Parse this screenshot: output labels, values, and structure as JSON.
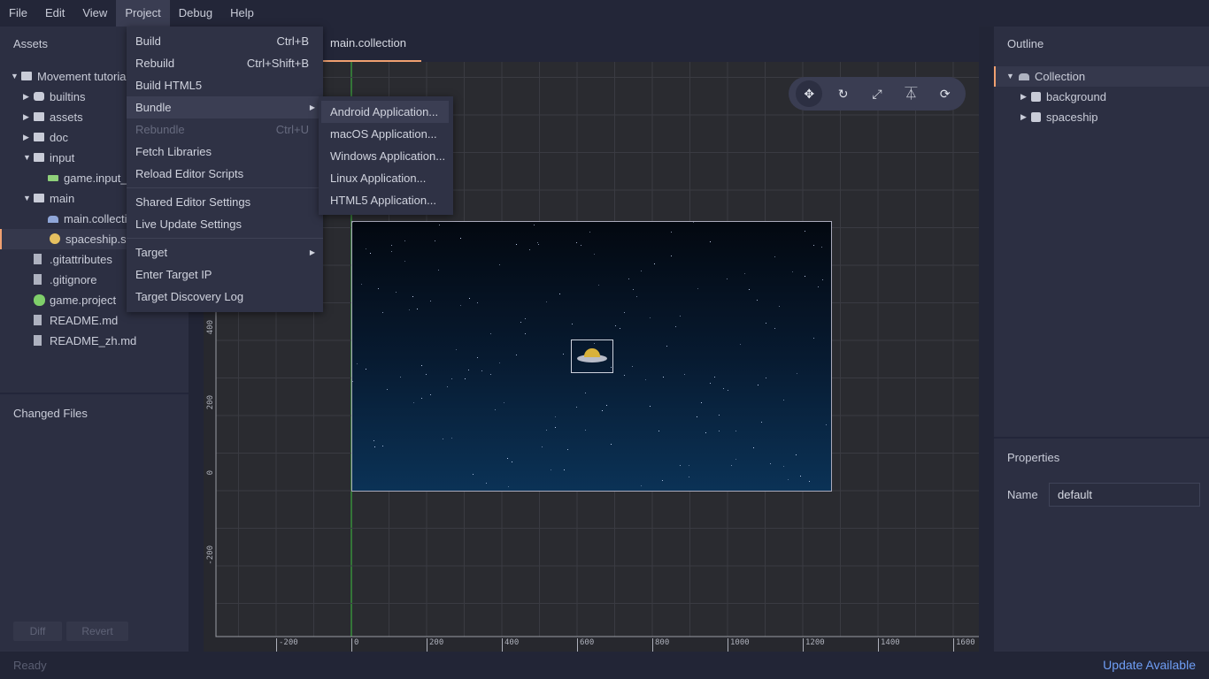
{
  "menubar": {
    "items": [
      "File",
      "Edit",
      "View",
      "Project",
      "Debug",
      "Help"
    ],
    "open": "Project"
  },
  "assets": {
    "title": "Assets",
    "tree": [
      {
        "label": "Movement tutorial",
        "icon": "folder-icon",
        "indent": 0,
        "expanded": true
      },
      {
        "label": "builtins",
        "icon": "puzzle-icon",
        "indent": 1,
        "expanded": false
      },
      {
        "label": "assets",
        "icon": "folder-icon",
        "indent": 1,
        "expanded": false
      },
      {
        "label": "doc",
        "icon": "folder-icon",
        "indent": 1,
        "expanded": false
      },
      {
        "label": "input",
        "icon": "folder-icon",
        "indent": 1,
        "expanded": true
      },
      {
        "label": "game.input_binding",
        "icon": "input-binding-icon",
        "indent": 2
      },
      {
        "label": "main",
        "icon": "folder-icon",
        "indent": 1,
        "expanded": true
      },
      {
        "label": "main.collection",
        "icon": "collection-icon",
        "indent": 2
      },
      {
        "label": "spaceship.script",
        "icon": "script-gear-icon",
        "indent": 2,
        "selected": true
      },
      {
        "label": ".gitattributes",
        "icon": "file-icon",
        "indent": 1
      },
      {
        "label": ".gitignore",
        "icon": "file-icon",
        "indent": 1
      },
      {
        "label": "game.project",
        "icon": "project-icon",
        "indent": 1
      },
      {
        "label": "README.md",
        "icon": "file-icon",
        "indent": 1
      },
      {
        "label": "README_zh.md",
        "icon": "file-icon",
        "indent": 1
      }
    ]
  },
  "changed_files": {
    "title": "Changed Files",
    "diff": "Diff",
    "revert": "Revert"
  },
  "tab": {
    "label": "main.collection"
  },
  "project_menu": [
    {
      "label": "Build",
      "shortcut": "Ctrl+B"
    },
    {
      "label": "Rebuild",
      "shortcut": "Ctrl+Shift+B"
    },
    {
      "label": "Build HTML5",
      "shortcut": ""
    },
    {
      "label": "Bundle",
      "shortcut": "",
      "submenu": true,
      "highlighted": true
    },
    {
      "label": "Rebundle",
      "shortcut": "Ctrl+U",
      "disabled": true
    },
    {
      "label": "Fetch Libraries",
      "shortcut": ""
    },
    {
      "label": "Reload Editor Scripts",
      "shortcut": ""
    },
    {
      "sep": true
    },
    {
      "label": "Shared Editor Settings",
      "shortcut": ""
    },
    {
      "label": "Live Update Settings",
      "shortcut": ""
    },
    {
      "sep": true
    },
    {
      "label": "Target",
      "shortcut": "",
      "submenu": true
    },
    {
      "label": "Enter Target IP",
      "shortcut": ""
    },
    {
      "label": "Target Discovery Log",
      "shortcut": ""
    }
  ],
  "bundle_menu": [
    "Android Application...",
    "macOS Application...",
    "Windows Application...",
    "Linux Application...",
    "HTML5 Application..."
  ],
  "toolbar": [
    "move-tool-icon",
    "rotate-tool-icon",
    "scale-tool-icon",
    "perspective-toggle-icon",
    "visibility-icon"
  ],
  "x_ticks": [
    "-200",
    "0",
    "200",
    "400",
    "600",
    "800",
    "1000",
    "1200",
    "1400",
    "1600"
  ],
  "y_ticks": [
    "400",
    "200",
    "0",
    "-200"
  ],
  "outline": {
    "title": "Outline",
    "root": "Collection",
    "children": [
      "background",
      "spaceship"
    ]
  },
  "properties": {
    "title": "Properties",
    "name_label": "Name",
    "name_value": "default"
  },
  "status": {
    "left": "Ready",
    "right": "Update Available"
  },
  "colors": {
    "accent": "#f0a070",
    "link": "#6f9ef5",
    "y_axis": "#3fbf3f"
  }
}
